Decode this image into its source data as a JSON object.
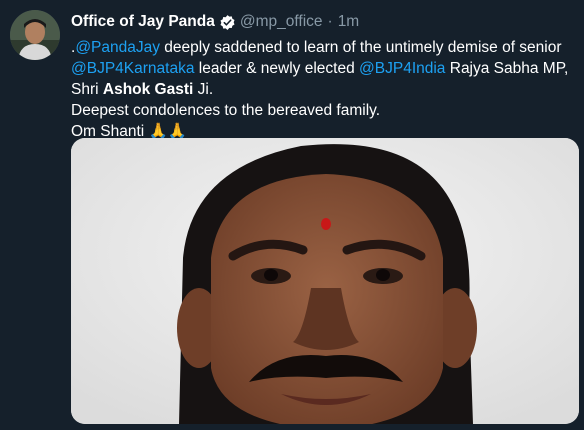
{
  "tweet": {
    "display_name": "Office of Jay Panda",
    "handle": "@mp_office",
    "separator": "·",
    "time": "1m",
    "text": {
      "prefix": ".",
      "mention_1": "@PandaJay",
      "line1_rest": " deeply saddened to learn of the untimely demise of senior",
      "mention_2": "@BJP4Karnataka",
      "line2_mid": " leader & newly elected ",
      "mention_3": "@BJP4India",
      "line2_rest": " Rajya Sabha MP,",
      "line3_prefix": "Shri ",
      "line3_bold": "Ashok Gasti",
      "line3_rest": " Ji.",
      "line4": "Deepest condolences to the bereaved family.",
      "line5": "Om Shanti 🙏🙏"
    },
    "colors": {
      "background": "#15202b",
      "link": "#1da1f2",
      "muted": "#8899a6",
      "verified": "#ffffff"
    },
    "icons": {
      "verified": "verified-badge-icon"
    }
  }
}
